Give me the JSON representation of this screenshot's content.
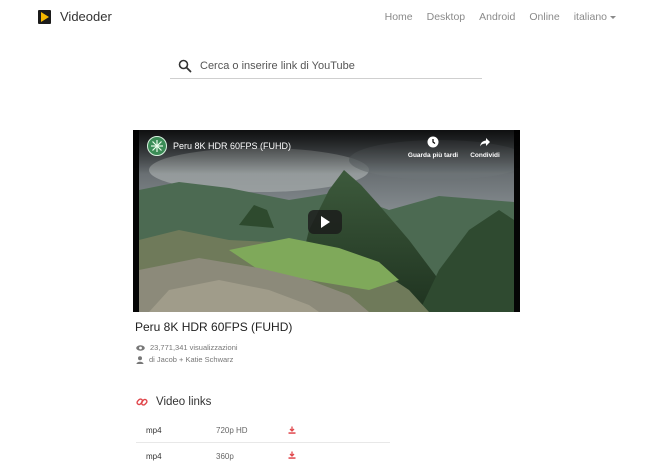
{
  "app": {
    "name": "Videoder"
  },
  "nav": {
    "items": [
      "Home",
      "Desktop",
      "Android",
      "Online"
    ],
    "language": "italiano"
  },
  "search": {
    "placeholder": "Cerca o inserire link di YouTube"
  },
  "player": {
    "title": "Peru 8K HDR 60FPS (FUHD)",
    "watch_later": "Guarda più tardi",
    "share": "Condividi"
  },
  "video": {
    "title": "Peru 8K HDR 60FPS (FUHD)",
    "views": "23,771,341 visualizzazioni",
    "author": "di Jacob + Katie Schwarz"
  },
  "links": {
    "heading": "Video links",
    "rows": [
      {
        "format": "mp4",
        "quality": "720p HD"
      },
      {
        "format": "mp4",
        "quality": "360p"
      }
    ]
  },
  "colors": {
    "accent": "#e0474c",
    "brand_logo_play": "#f5b800"
  }
}
